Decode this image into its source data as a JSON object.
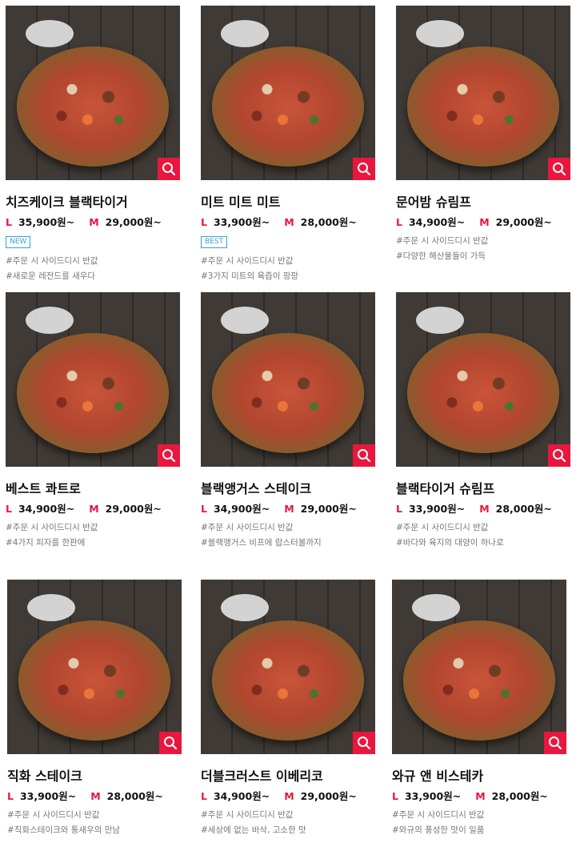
{
  "products": [
    {
      "name": "치즈케이크 블랙타이거",
      "size_l": "L",
      "price_l": "35,900원~",
      "size_m": "M",
      "price_m": "29,000원~",
      "badge": "NEW",
      "tags": [
        "#주문 시 사이드디시 반값",
        "#새로운 레전드를 새우다"
      ]
    },
    {
      "name": "미트 미트 미트",
      "size_l": "L",
      "price_l": "33,900원~",
      "size_m": "M",
      "price_m": "28,000원~",
      "badge": "BEST",
      "tags": [
        "#주문 시 사이드디시 반값",
        "#3가지 미트의 육즙이 팡팡"
      ]
    },
    {
      "name": "문어밤 슈림프",
      "size_l": "L",
      "price_l": "34,900원~",
      "size_m": "M",
      "price_m": "29,000원~",
      "badge": "",
      "tags": [
        "#주문 시 사이드디시 반값",
        "#다양한 해산물들이 가득"
      ]
    },
    {
      "name": "베스트 콰트로",
      "size_l": "L",
      "price_l": "34,900원~",
      "size_m": "M",
      "price_m": "29,000원~",
      "badge": "",
      "tags": [
        "#주문 시 사이드디시 반값",
        "#4가지 피자를 한판에"
      ]
    },
    {
      "name": "블랙앵거스 스테이크",
      "size_l": "L",
      "price_l": "34,900원~",
      "size_m": "M",
      "price_m": "29,000원~",
      "badge": "",
      "tags": [
        "#주문 시 사이드디시 반값",
        "#블랙앵거스 비프에 랍스터볼까지"
      ]
    },
    {
      "name": "블랙타이거 슈림프",
      "size_l": "L",
      "price_l": "33,900원~",
      "size_m": "M",
      "price_m": "28,000원~",
      "badge": "",
      "tags": [
        "#주문 시 사이드디시 반값",
        "#바다와 육지의 대양이 하나로"
      ]
    },
    {
      "name": "직화 스테이크",
      "size_l": "L",
      "price_l": "33,900원~",
      "size_m": "M",
      "price_m": "28,000원~",
      "badge": "",
      "tags": [
        "#주문 시 사이드디시 반값",
        "#직화스테이크와 통새우의 만남"
      ]
    },
    {
      "name": "더블크러스트 이베리코",
      "size_l": "L",
      "price_l": "34,900원~",
      "size_m": "M",
      "price_m": "29,000원~",
      "badge": "",
      "tags": [
        "#주문 시 사이드디시 반값",
        "#세상에 없는 바삭, 고소한 맛"
      ]
    },
    {
      "name": "와규 앤 비스테카",
      "size_l": "L",
      "price_l": "33,900원~",
      "size_m": "M",
      "price_m": "28,000원~",
      "badge": "",
      "tags": [
        "#주문 시 사이드디시 반값",
        "#와규의 풍성한 맛이 일품"
      ]
    }
  ],
  "icons": {
    "zoom": "magnifier-icon"
  },
  "colors": {
    "accent": "#e8173e",
    "badge": "#3aa0d8"
  }
}
